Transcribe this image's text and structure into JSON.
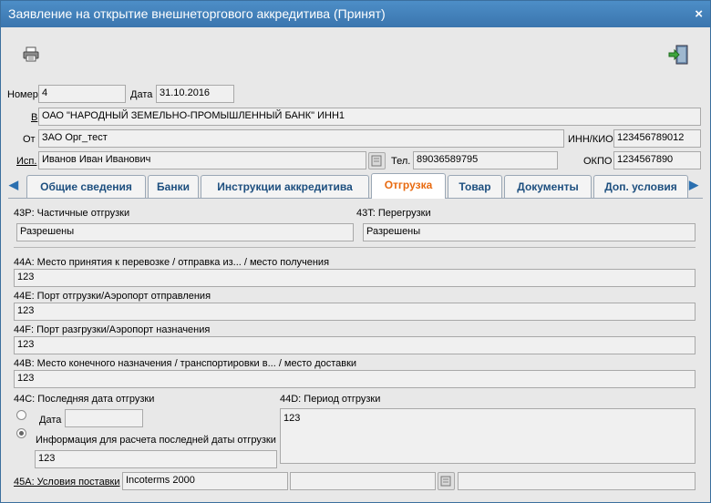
{
  "window": {
    "title": "Заявление на открытие внешнеторгового аккредитива (Принят)",
    "close": "×"
  },
  "header": {
    "number_label": "Номер",
    "number_value": "4",
    "date_label": "Дата",
    "date_value": "31.10.2016",
    "bank_label": "В",
    "bank_value": "ОАО \"НАРОДНЫЙ ЗЕМЕЛЬНО-ПРОМЫШЛЕННЫЙ БАНК\" ИНН1",
    "from_label": "От",
    "from_value": "ЗАО Орг_тест",
    "inn_label": "ИНН/КИО",
    "inn_value": "123456789012",
    "executor_label": "Исп.",
    "executor_value": "Иванов Иван Иванович",
    "phone_label": "Тел.",
    "phone_value": "89036589795",
    "okpo_label": "ОКПО",
    "okpo_value": "1234567890"
  },
  "tabs": [
    {
      "label": "Общие сведения"
    },
    {
      "label": "Банки"
    },
    {
      "label": "Инструкции аккредитива"
    },
    {
      "label": "Отгрузка"
    },
    {
      "label": "Товар"
    },
    {
      "label": "Документы"
    },
    {
      "label": "Доп. условия"
    }
  ],
  "shipment": {
    "partial_label": "43P: Частичные отгрузки",
    "partial_value": "Разрешены",
    "transship_label": "43T: Перегрузки",
    "transship_value": "Разрешены",
    "f44a_label": "44A: Место принятия к перевозке / отправка из... / место получения",
    "f44a_value": "123",
    "f44e_label": "44E: Порт отгрузки/Аэропорт отправления",
    "f44e_value": "123",
    "f44f_label": "44F: Порт разгрузки/Аэропорт назначения",
    "f44f_value": "123",
    "f44b_label": "44B: Место конечного назначения / транспортировки в... / место доставки",
    "f44b_value": "123",
    "f44c_label": "44C: Последняя дата отгрузки",
    "date_option_label": "Дата",
    "date_option_value": "",
    "info_option_label": "Информация для расчета последней даты отгрузки",
    "info_option_value": "123",
    "f44d_label": "44D: Период отгрузки",
    "f44d_value": "123",
    "f45a_label": "45A: Условия поставки",
    "f45a_value": "Incoterms 2000",
    "f45a_extra1": "",
    "f45a_extra2": ""
  }
}
